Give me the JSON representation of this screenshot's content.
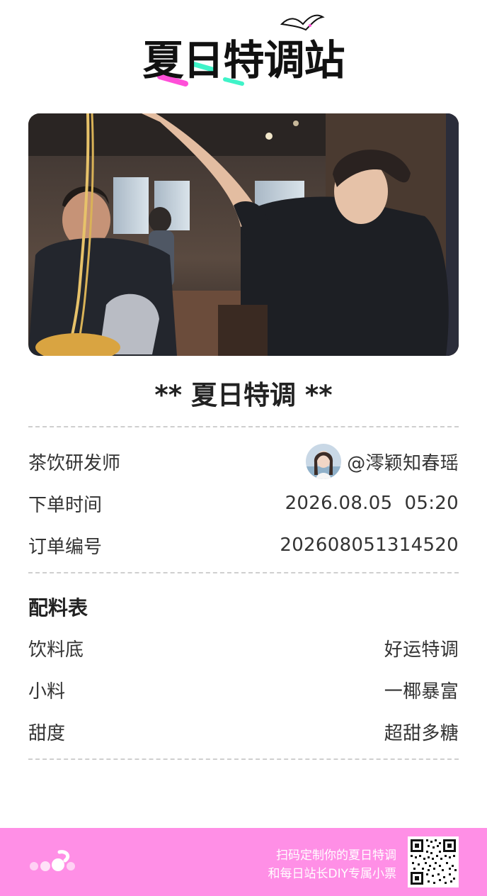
{
  "logo": {
    "text": "夏日特调站",
    "accent_colors": [
      "#ff4fd8",
      "#3ff3c8"
    ]
  },
  "photo": {
    "alt_icon": "photo-image"
  },
  "receipt": {
    "title": "** 夏日特调 **",
    "rows": [
      {
        "label": "茶饮研发师",
        "value": "@澪颖知春瑶"
      },
      {
        "label": "下单时间",
        "value": "2026.08.05  05:20"
      },
      {
        "label": "订单编号",
        "value": "202608051314520"
      }
    ],
    "recipe_title": "配料表",
    "recipe": [
      {
        "label": "饮料底",
        "value": "好运特调"
      },
      {
        "label": "小料",
        "value": "一椰暴富"
      },
      {
        "label": "甜度",
        "value": "超甜多糖"
      }
    ]
  },
  "footer": {
    "line1": "扫码定制你的夏日特调",
    "line2": "和每日站长DIY专属小票",
    "background": "#ff8fe6"
  }
}
